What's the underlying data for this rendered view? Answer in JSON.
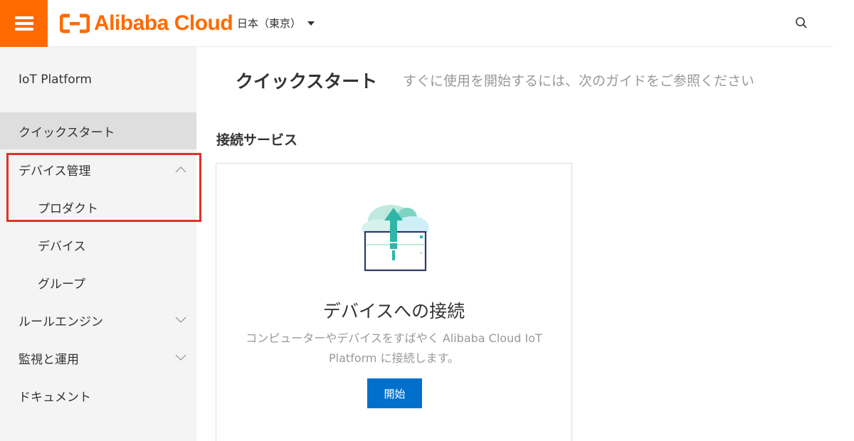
{
  "header": {
    "menu_icon": "hamburger-menu-icon",
    "logo_text": "Alibaba Cloud",
    "brand_color": "#ff6a00",
    "region_label": "日本（東京）",
    "search_icon": "search-icon"
  },
  "sidebar": {
    "title": "IoT Platform",
    "items": [
      {
        "label": "クイックスタート",
        "active": true
      },
      {
        "label": "デバイス管理",
        "expanded": true,
        "icon": "chevron-up-icon"
      },
      {
        "label": "プロダクト",
        "sub": true
      },
      {
        "label": "デバイス",
        "sub": true
      },
      {
        "label": "グループ",
        "sub": true
      },
      {
        "label": "ルールエンジン",
        "expanded": false,
        "icon": "chevron-down-icon"
      },
      {
        "label": "監視と運用",
        "expanded": false,
        "icon": "chevron-down-icon"
      },
      {
        "label": "ドキュメント"
      }
    ],
    "highlight_color": "#e0312a"
  },
  "main": {
    "title": "クイックスタート",
    "subtitle": "すぐに使用を開始するには、次のガイドをご参照ください",
    "section_title": "接続サービス",
    "card": {
      "icon": "cloud-upload-icon",
      "title": "デバイスへの接続",
      "description": "コンピューターやデバイスをすばやく Alibaba Cloud IoT Platform に接続します。",
      "button_label": "開始",
      "button_color": "#0070cc"
    }
  }
}
